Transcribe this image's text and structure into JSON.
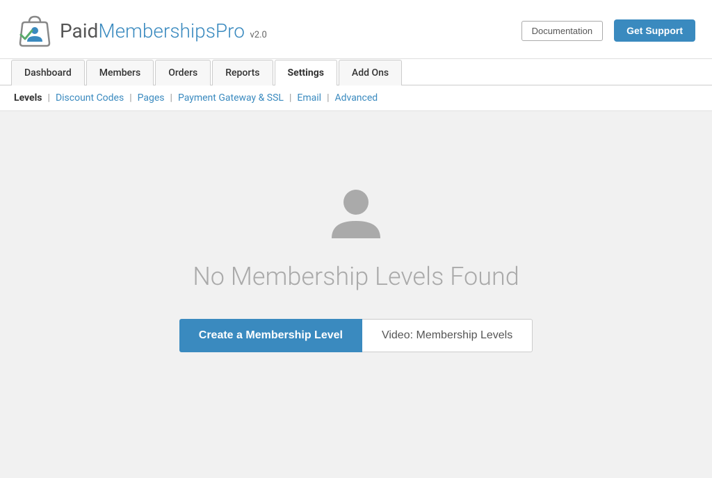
{
  "header": {
    "logo_text_paid": "Paid",
    "logo_text_memberships": "Memberships",
    "logo_text_pro": "Pro",
    "version": "v2.0",
    "btn_documentation": "Documentation",
    "btn_get_support": "Get Support"
  },
  "nav_tabs": [
    {
      "id": "dashboard",
      "label": "Dashboard",
      "active": false
    },
    {
      "id": "members",
      "label": "Members",
      "active": false
    },
    {
      "id": "orders",
      "label": "Orders",
      "active": false
    },
    {
      "id": "reports",
      "label": "Reports",
      "active": false
    },
    {
      "id": "settings",
      "label": "Settings",
      "active": true
    },
    {
      "id": "add-ons",
      "label": "Add Ons",
      "active": false
    }
  ],
  "sub_nav": [
    {
      "id": "levels",
      "label": "Levels",
      "active": true
    },
    {
      "id": "discount-codes",
      "label": "Discount Codes",
      "active": false
    },
    {
      "id": "pages",
      "label": "Pages",
      "active": false
    },
    {
      "id": "payment-gateway",
      "label": "Payment Gateway & SSL",
      "active": false
    },
    {
      "id": "email",
      "label": "Email",
      "active": false
    },
    {
      "id": "advanced",
      "label": "Advanced",
      "active": false
    }
  ],
  "main": {
    "empty_title": "No Membership Levels Found",
    "btn_create": "Create a Membership Level",
    "btn_video": "Video: Membership Levels"
  }
}
